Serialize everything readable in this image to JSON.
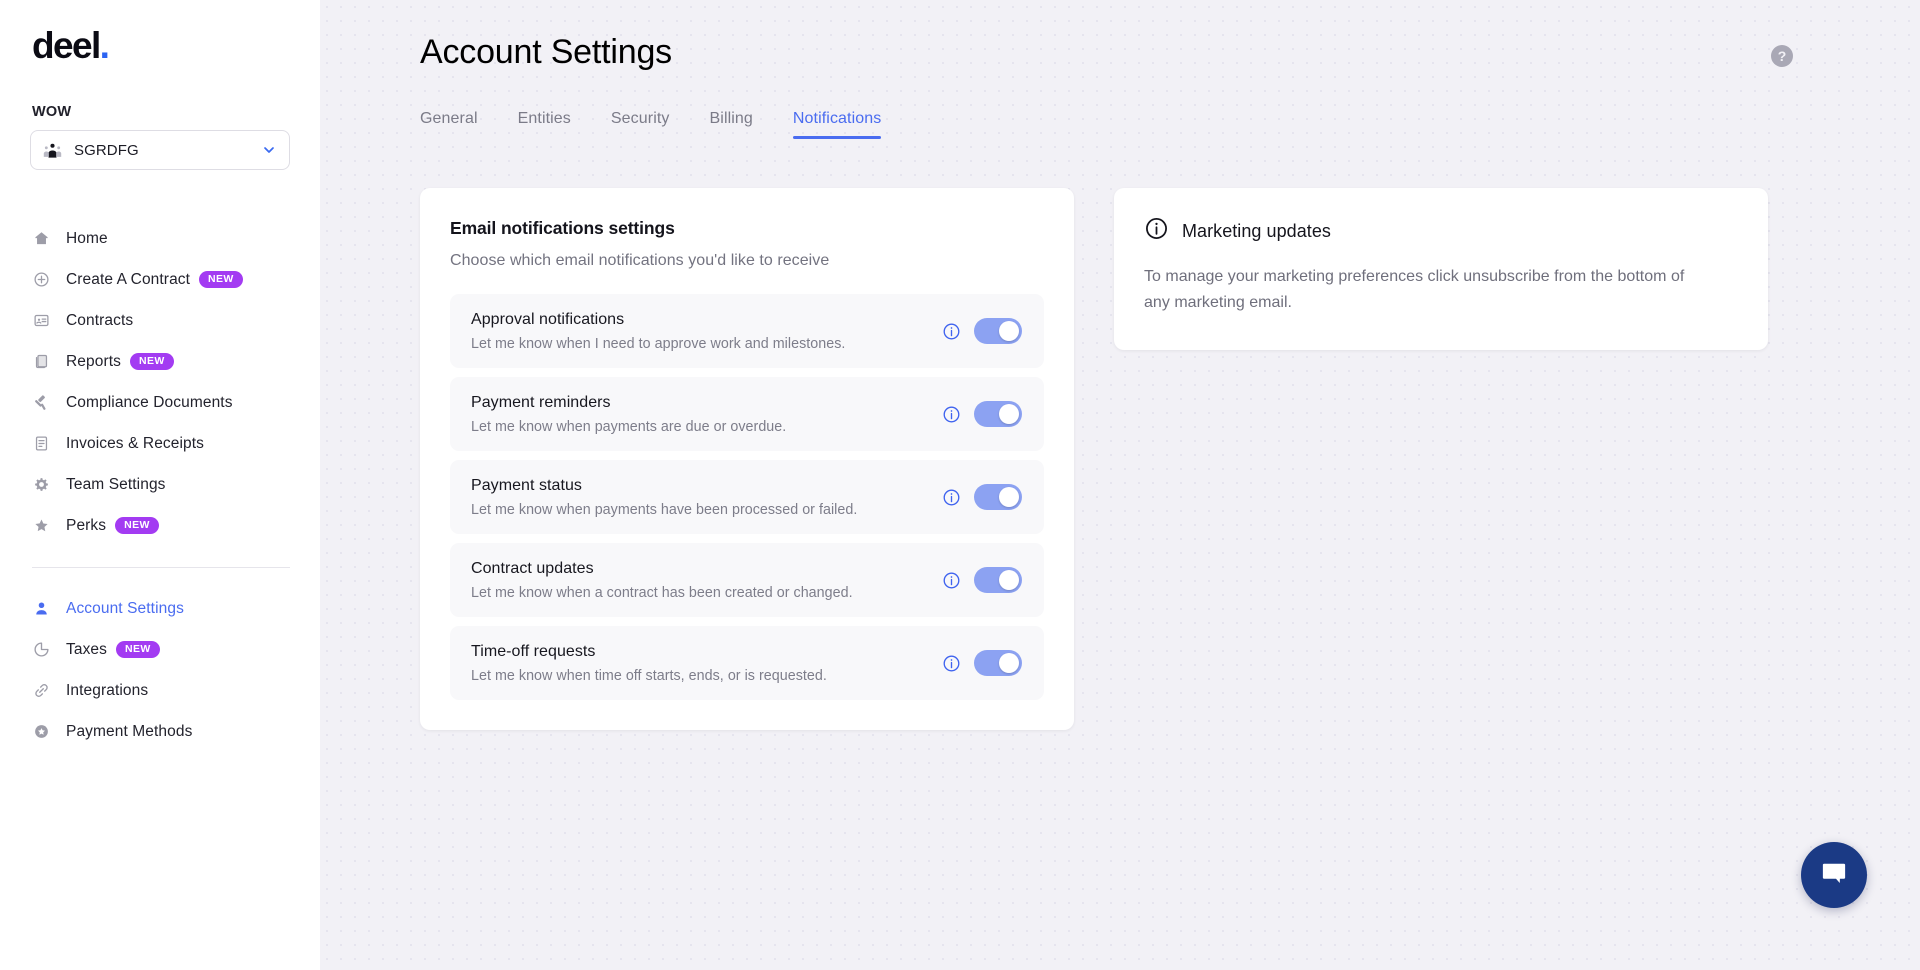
{
  "brand": {
    "logo_text": "deel",
    "logo_dot": ".",
    "accent_blue": "#4a6cf0",
    "badge_purple": "#a33bf2",
    "chat_navy": "#1b3a85"
  },
  "sidebar": {
    "org_label": "WOW",
    "org_name": "SGRDFG",
    "items": [
      {
        "label": "Home",
        "icon": "home-icon",
        "badge": "",
        "active": false
      },
      {
        "label": "Create A Contract",
        "icon": "plus-circle-icon",
        "badge": "NEW",
        "active": false
      },
      {
        "label": "Contracts",
        "icon": "contract-card-icon",
        "badge": "",
        "active": false
      },
      {
        "label": "Reports",
        "icon": "documents-icon",
        "badge": "NEW",
        "active": false
      },
      {
        "label": "Compliance Documents",
        "icon": "gavel-icon",
        "badge": "",
        "active": false
      },
      {
        "label": "Invoices & Receipts",
        "icon": "invoice-icon",
        "badge": "",
        "active": false
      },
      {
        "label": "Team Settings",
        "icon": "gear-icon",
        "badge": "",
        "active": false
      },
      {
        "label": "Perks",
        "icon": "star-icon",
        "badge": "NEW",
        "active": false
      }
    ],
    "items_secondary": [
      {
        "label": "Account Settings",
        "icon": "user-icon",
        "badge": "",
        "active": true
      },
      {
        "label": "Taxes",
        "icon": "pie-chart-icon",
        "badge": "NEW",
        "active": false
      },
      {
        "label": "Integrations",
        "icon": "link-icon",
        "badge": "",
        "active": false
      },
      {
        "label": "Payment Methods",
        "icon": "payment-star-icon",
        "badge": "",
        "active": false
      }
    ]
  },
  "header": {
    "title": "Account Settings",
    "help_glyph": "?"
  },
  "tabs": [
    {
      "label": "General",
      "active": false
    },
    {
      "label": "Entities",
      "active": false
    },
    {
      "label": "Security",
      "active": false
    },
    {
      "label": "Billing",
      "active": false
    },
    {
      "label": "Notifications",
      "active": true
    }
  ],
  "email_settings": {
    "title": "Email notifications settings",
    "subtitle": "Choose which email notifications you'd like to receive",
    "rows": [
      {
        "title": "Approval notifications",
        "desc": "Let me know when I need to approve work and milestones.",
        "enabled": true
      },
      {
        "title": "Payment reminders",
        "desc": "Let me know when payments are due or overdue.",
        "enabled": true
      },
      {
        "title": "Payment status",
        "desc": "Let me know when payments have been processed or failed.",
        "enabled": true
      },
      {
        "title": "Contract updates",
        "desc": "Let me know when a contract has been created or changed.",
        "enabled": true
      },
      {
        "title": "Time-off requests",
        "desc": "Let me know when time off starts, ends, or is requested.",
        "enabled": true
      }
    ]
  },
  "marketing": {
    "title": "Marketing updates",
    "body": "To manage your marketing preferences click unsubscribe from the bottom of any marketing email."
  }
}
